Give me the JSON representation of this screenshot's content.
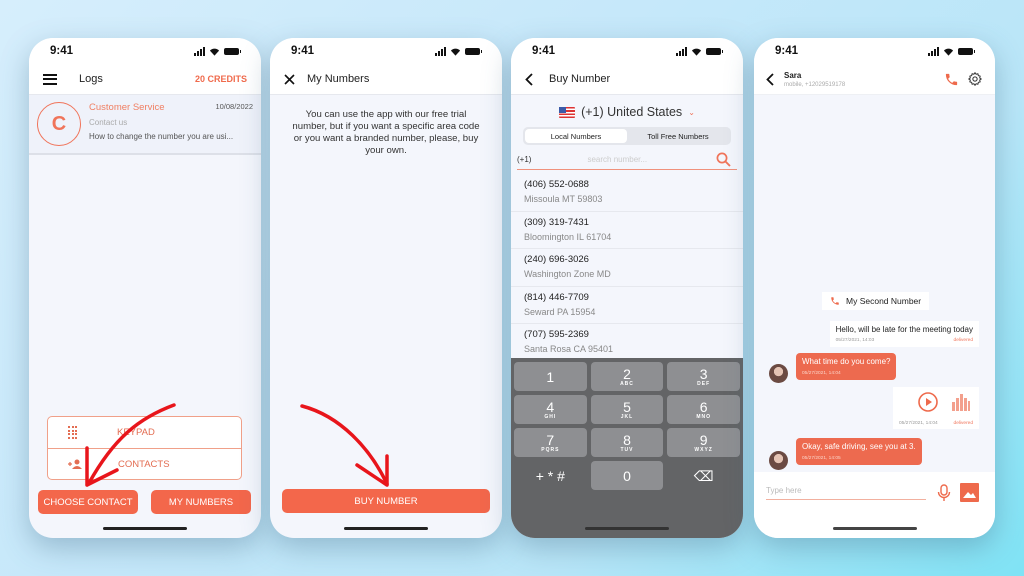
{
  "colors": {
    "accent": "#f3674b",
    "arrow": "#e8151b",
    "keypad_bg": "#636466"
  },
  "status": {
    "time": "9:41"
  },
  "screens": {
    "logs": {
      "title": "Logs",
      "credits": "20 CREDITS",
      "items": [
        {
          "initial": "C",
          "name": "Customer Service",
          "date": "10/08/2022",
          "subtitle": "Contact us",
          "preview": "How to change the number you are usi..."
        }
      ],
      "actions": [
        {
          "icon": "keypad-icon",
          "label": "KEYPAD"
        },
        {
          "icon": "add-contact-icon",
          "label": "CONTACTS"
        }
      ],
      "buttons": {
        "choose_contact": "CHOOSE CONTACT",
        "my_numbers": "MY NUMBERS"
      }
    },
    "my_numbers": {
      "title": "My Numbers",
      "info": "You can use the app with our free trial number, but if you want a specific area code or you want a branded number, please, buy your own.",
      "buy_button": "BUY NUMBER"
    },
    "buy_number": {
      "title": "Buy Number",
      "country": "(+1) United States",
      "tabs": [
        {
          "label": "Local Numbers",
          "active": true
        },
        {
          "label": "Toll Free Numbers",
          "active": false
        }
      ],
      "search": {
        "prefix": "(+1)",
        "placeholder": "search number..."
      },
      "numbers": [
        {
          "number": "(406) 552-0688",
          "location": "Missoula MT 59803"
        },
        {
          "number": "(309) 319-7431",
          "location": "Bloomington IL 61704"
        },
        {
          "number": "(240) 696-3026",
          "location": "Washington Zone MD"
        },
        {
          "number": "(814) 446-7709",
          "location": "Seward PA 15954"
        },
        {
          "number": "(707) 595-2369",
          "location": "Santa Rosa CA 95401"
        }
      ],
      "keys": [
        {
          "digit": "1",
          "letters": ""
        },
        {
          "digit": "2",
          "letters": "ABC"
        },
        {
          "digit": "3",
          "letters": "DEF"
        },
        {
          "digit": "4",
          "letters": "GHI"
        },
        {
          "digit": "5",
          "letters": "JKL"
        },
        {
          "digit": "6",
          "letters": "MNO"
        },
        {
          "digit": "7",
          "letters": "PQRS"
        },
        {
          "digit": "8",
          "letters": "TUV"
        },
        {
          "digit": "9",
          "letters": "WXYZ"
        },
        {
          "digit": "+ * #",
          "letters": ""
        },
        {
          "digit": "0",
          "letters": ""
        },
        {
          "digit": "⌫",
          "letters": ""
        }
      ]
    },
    "chat": {
      "contact_name": "Sara",
      "contact_sub": "mobile, +12029519178",
      "system_label": "My Second Number",
      "messages": [
        {
          "dir": "out",
          "text": "Hello, will be late for the meeting today",
          "time": "05/27/2021, 14:03",
          "status": "delivered"
        },
        {
          "dir": "in",
          "text": "What time do you come?",
          "time": "05/27/2021, 14:04"
        },
        {
          "dir": "out",
          "type": "audio",
          "time": "05/27/2021, 14:04",
          "status": "delivered"
        },
        {
          "dir": "in",
          "text": "Okay, safe driving, see you at 3.",
          "time": "05/27/2021, 14:05"
        }
      ],
      "input_placeholder": "Type here"
    }
  }
}
